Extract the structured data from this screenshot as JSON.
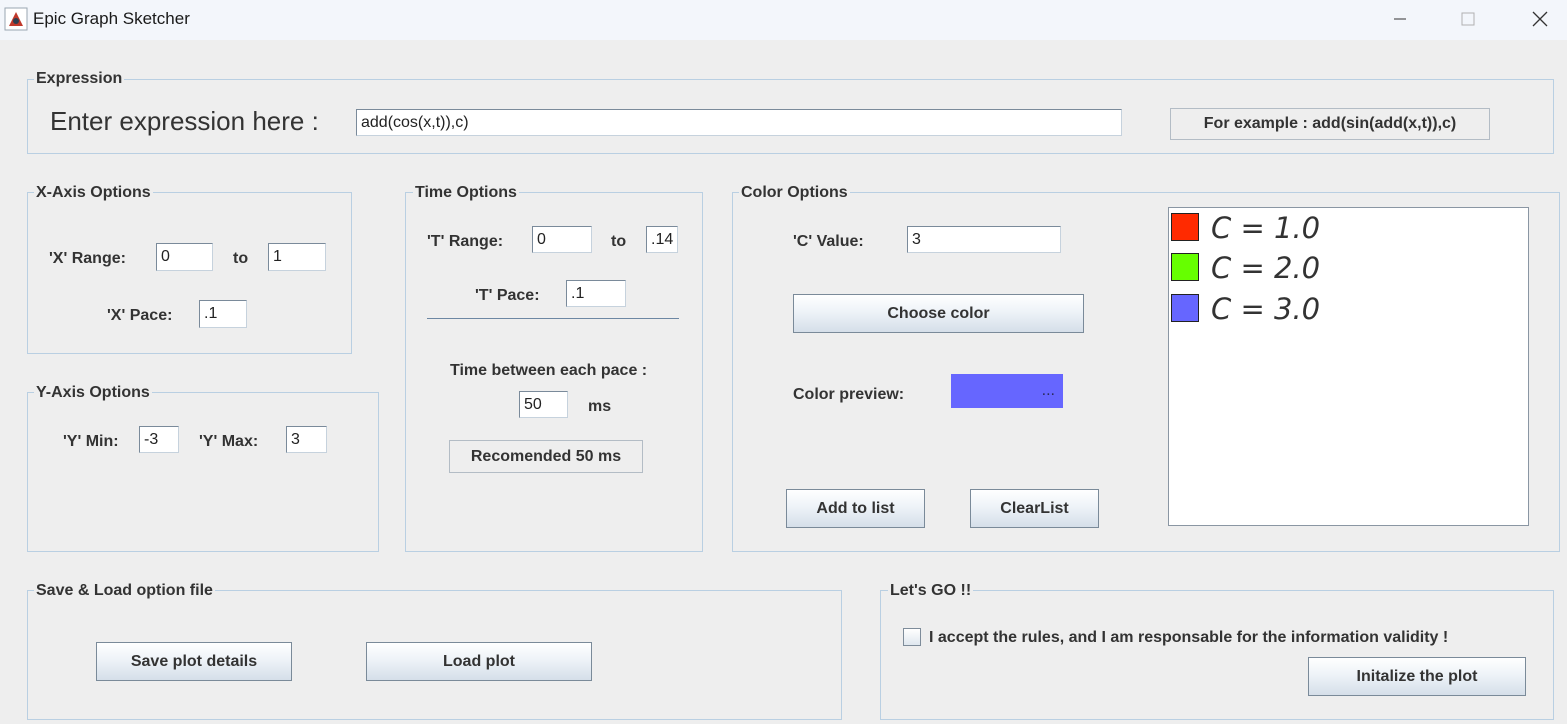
{
  "window": {
    "title": "Epic Graph Sketcher",
    "controls": [
      "minimize-icon",
      "maximize-icon",
      "close-icon"
    ]
  },
  "expression": {
    "group_title": "Expression",
    "prompt": "Enter expression here :",
    "value": "add(cos(x,t)),c)",
    "example_button": "For example : add(sin(add(x,t)),c)"
  },
  "x_axis": {
    "group_title": "X-Axis Options",
    "range_label": "'X' Range:",
    "range_from": "0",
    "to_label": "to",
    "range_to": "1",
    "pace_label": "'X' Pace:",
    "pace": ".1"
  },
  "y_axis": {
    "group_title": "Y-Axis Options",
    "min_label": "'Y' Min:",
    "min": "-3",
    "max_label": "'Y' Max:",
    "max": "3"
  },
  "time": {
    "group_title": "Time Options",
    "range_label": "'T' Range:",
    "range_from": "0",
    "to_label": "to",
    "range_to": ".14",
    "pace_label": "'T' Pace:",
    "pace": ".1",
    "between_label": "Time between each pace :",
    "between_value": "50",
    "unit": "ms",
    "recommended_button": "Recomended 50 ms"
  },
  "color": {
    "group_title": "Color Options",
    "c_label": "'C' Value:",
    "c_value": "3",
    "choose_button": "Choose color",
    "preview_label": "Color preview:",
    "preview_color": "#6666ff",
    "preview_dots": "...",
    "add_button": "Add to list",
    "clear_button": "ClearList",
    "list": [
      {
        "text": "C = 1.0",
        "color": "#ff2a00"
      },
      {
        "text": "C = 2.0",
        "color": "#66ff00"
      },
      {
        "text": "C = 3.0",
        "color": "#6666ff"
      }
    ]
  },
  "save_load": {
    "group_title": "Save & Load option file",
    "save_button": "Save plot details",
    "load_button": "Load plot"
  },
  "go": {
    "group_title": "Let's GO !!",
    "accept_label": "I accept the rules, and I am responsable for the information validity !",
    "accepted": false,
    "init_button": "Initalize the plot"
  }
}
